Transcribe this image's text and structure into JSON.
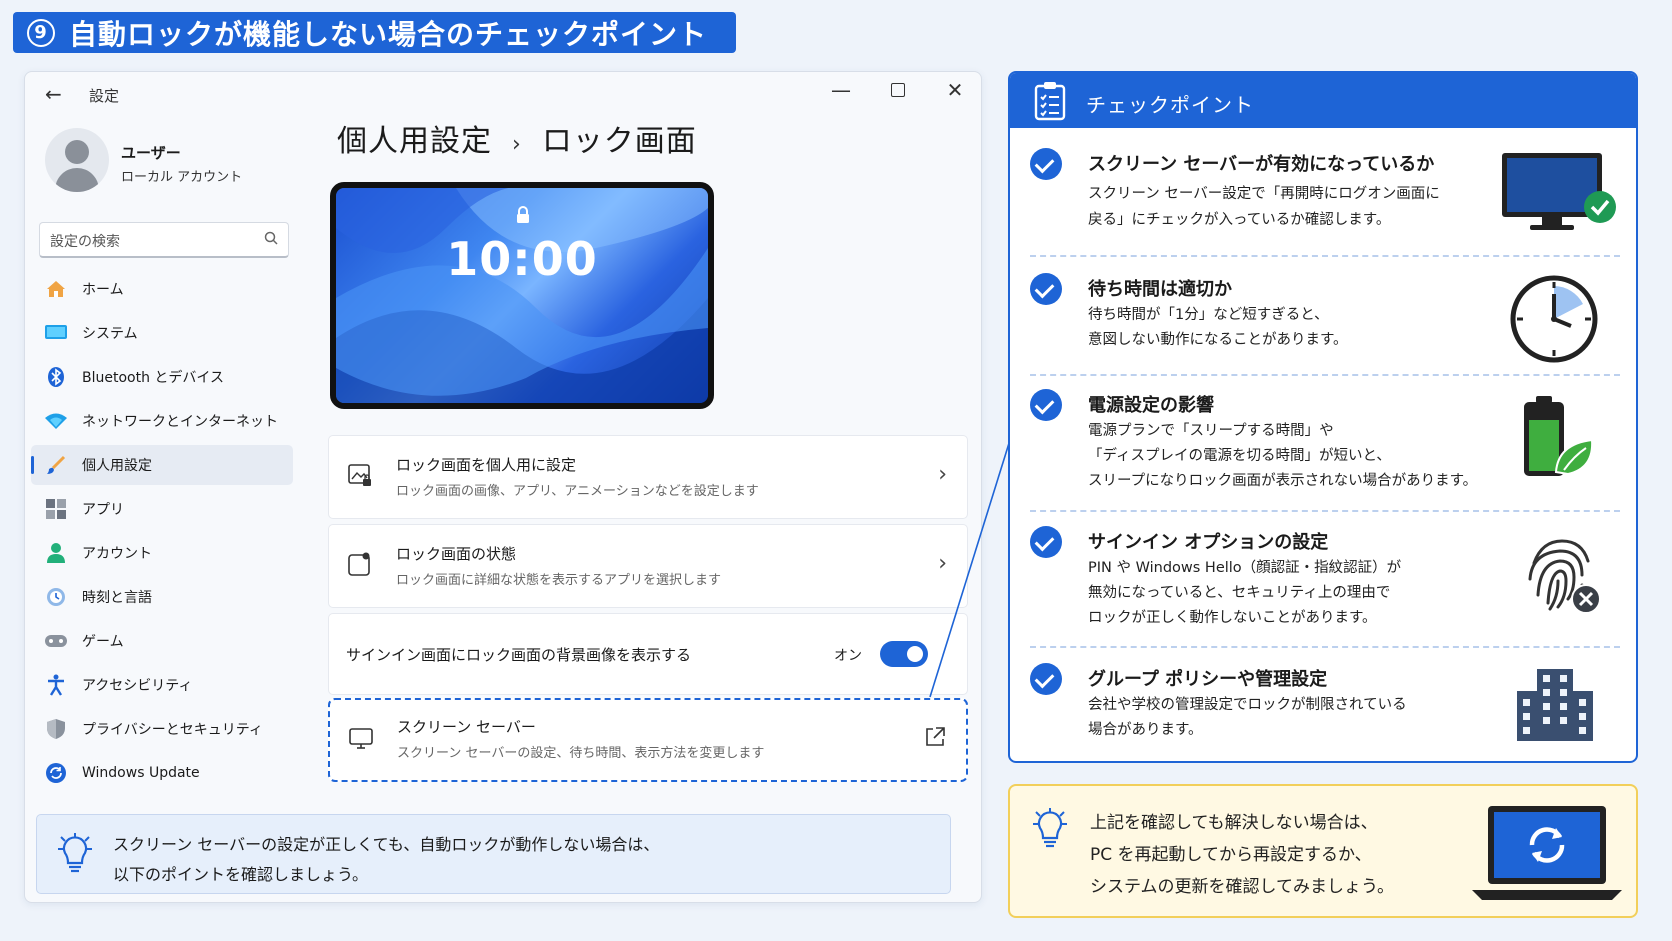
{
  "banner": {
    "number": "9",
    "title": "自動ロックが機能しない場合のチェックポイント"
  },
  "window": {
    "back": "←",
    "title": "設定",
    "min": "—",
    "close": "✕",
    "user": {
      "name": "ユーザー",
      "account": "ローカル アカウント"
    },
    "search": {
      "placeholder": "設定の検索",
      "icon": "⌕"
    },
    "nav": [
      {
        "label": "ホーム",
        "icon": "home-icon",
        "active": false
      },
      {
        "label": "システム",
        "icon": "system-icon",
        "active": false
      },
      {
        "label": "Bluetooth とデバイス",
        "icon": "bluetooth-icon",
        "active": false
      },
      {
        "label": "ネットワークとインターネット",
        "icon": "network-icon",
        "active": false
      },
      {
        "label": "個人用設定",
        "icon": "brush-icon",
        "active": true
      },
      {
        "label": "アプリ",
        "icon": "apps-icon",
        "active": false
      },
      {
        "label": "アカウント",
        "icon": "account-icon",
        "active": false
      },
      {
        "label": "時刻と言語",
        "icon": "time-language-icon",
        "active": false
      },
      {
        "label": "ゲーム",
        "icon": "gaming-icon",
        "active": false
      },
      {
        "label": "アクセシビリティ",
        "icon": "accessibility-icon",
        "active": false
      },
      {
        "label": "プライバシーとセキュリティ",
        "icon": "shield-icon",
        "active": false
      },
      {
        "label": "Windows Update",
        "icon": "update-icon",
        "active": false
      }
    ],
    "breadcrumb": {
      "parent": "個人用設定",
      "separator": "›",
      "current": "ロック画面"
    },
    "preview": {
      "time": "10:00"
    },
    "cards": {
      "personalize": {
        "title": "ロック画面を個人用に設定",
        "desc": "ロック画面の画像、アプリ、アニメーションなどを設定します"
      },
      "status": {
        "title": "ロック画面の状態",
        "desc": "ロック画面に詳細な状態を表示するアプリを選択します"
      },
      "signin_bg": {
        "title": "サインイン画面にロック画面の背景画像を表示する",
        "state": "オン",
        "on": true
      },
      "screensaver": {
        "title": "スクリーン セーバー",
        "desc": "スクリーン セーバーの設定、待ち時間、表示方法を変更します"
      }
    },
    "note": {
      "line1": "スクリーン セーバーの設定が正しくても、自動ロックが動作しない場合は、",
      "line2": "以下のポイントを確認しましょう。"
    }
  },
  "checkpoints": {
    "header": "チェックポイント",
    "items": [
      {
        "title": "スクリーン セーバーが有効になっているか",
        "lines": [
          "スクリーン セーバー設定で「再開時にログオン画面に",
          "戻る」にチェックが入っているか確認します。"
        ],
        "illustration": "monitor-check-icon"
      },
      {
        "title": "待ち時間は適切か",
        "lines": [
          "待ち時間が「1分」など短すぎると、",
          "意図しない動作になることがあります。"
        ],
        "illustration": "clock-icon"
      },
      {
        "title": "電源設定の影響",
        "lines": [
          "電源プランで「スリープする時間」や",
          "「ディスプレイの電源を切る時間」が短いと、",
          "スリープになりロック画面が表示されない場合があります。"
        ],
        "illustration": "battery-leaf-icon"
      },
      {
        "title": "サインイン オプションの設定",
        "lines": [
          "PIN や Windows Hello（顔認証・指紋認証）が",
          "無効になっていると、セキュリティ上の理由で",
          "ロックが正しく動作しないことがあります。"
        ],
        "illustration": "fingerprint-x-icon"
      },
      {
        "title": "グループ ポリシーや管理設定",
        "lines": [
          "会社や学校の管理設定でロックが制限されている",
          "場合があります。"
        ],
        "illustration": "building-icon"
      }
    ]
  },
  "tip": {
    "lines": [
      "上記を確認しても解決しない場合は、",
      "PC を再起動してから再設定するか、",
      "システムの更新を確認してみましょう。"
    ]
  },
  "colors": {
    "accent": "#1e64d6",
    "tip_bg": "#fff9e3",
    "tip_border": "#f2cf5a"
  }
}
